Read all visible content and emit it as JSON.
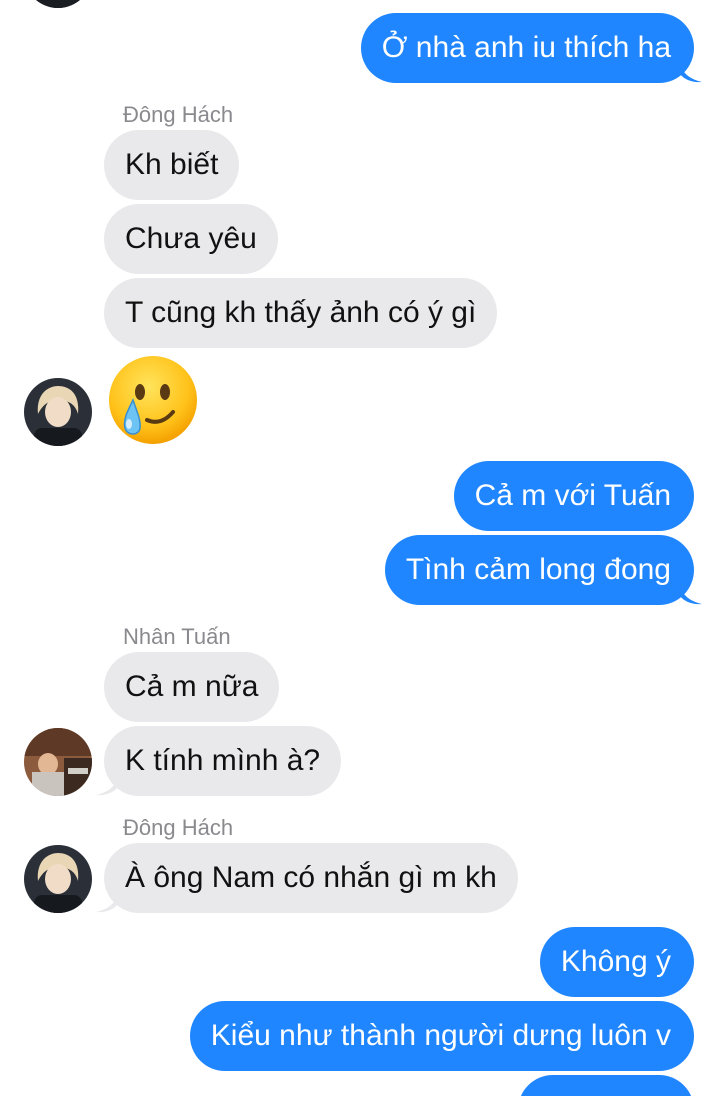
{
  "messages": [
    {
      "text": "Ở nhà anh iu thích ha",
      "direction": "sent"
    },
    {
      "sender": "Đông Hách",
      "text": "Kh biết",
      "direction": "received"
    },
    {
      "text": "Chưa yêu",
      "direction": "received"
    },
    {
      "text": "T cũng kh thấy ảnh có ý gì",
      "direction": "received"
    },
    {
      "emoji": "crying-smile-emoji",
      "direction": "received"
    },
    {
      "text": "Cả m với Tuấn",
      "direction": "sent"
    },
    {
      "text": "Tình cảm long đong",
      "direction": "sent"
    },
    {
      "sender": "Nhân Tuấn",
      "text": "Cả m nữa",
      "direction": "received"
    },
    {
      "text": "K tính mình à?",
      "direction": "received"
    },
    {
      "sender": "Đông Hách",
      "text": "À ông Nam có nhắn gì m kh",
      "direction": "received"
    },
    {
      "text": "Không ý",
      "direction": "sent"
    },
    {
      "text": "Kiểu như thành người dưng luôn v",
      "direction": "sent"
    }
  ],
  "colors": {
    "sent_bubble": "#1f86ff",
    "received_bubble": "#e9e9eb",
    "sender_name": "#8a8a8e"
  }
}
